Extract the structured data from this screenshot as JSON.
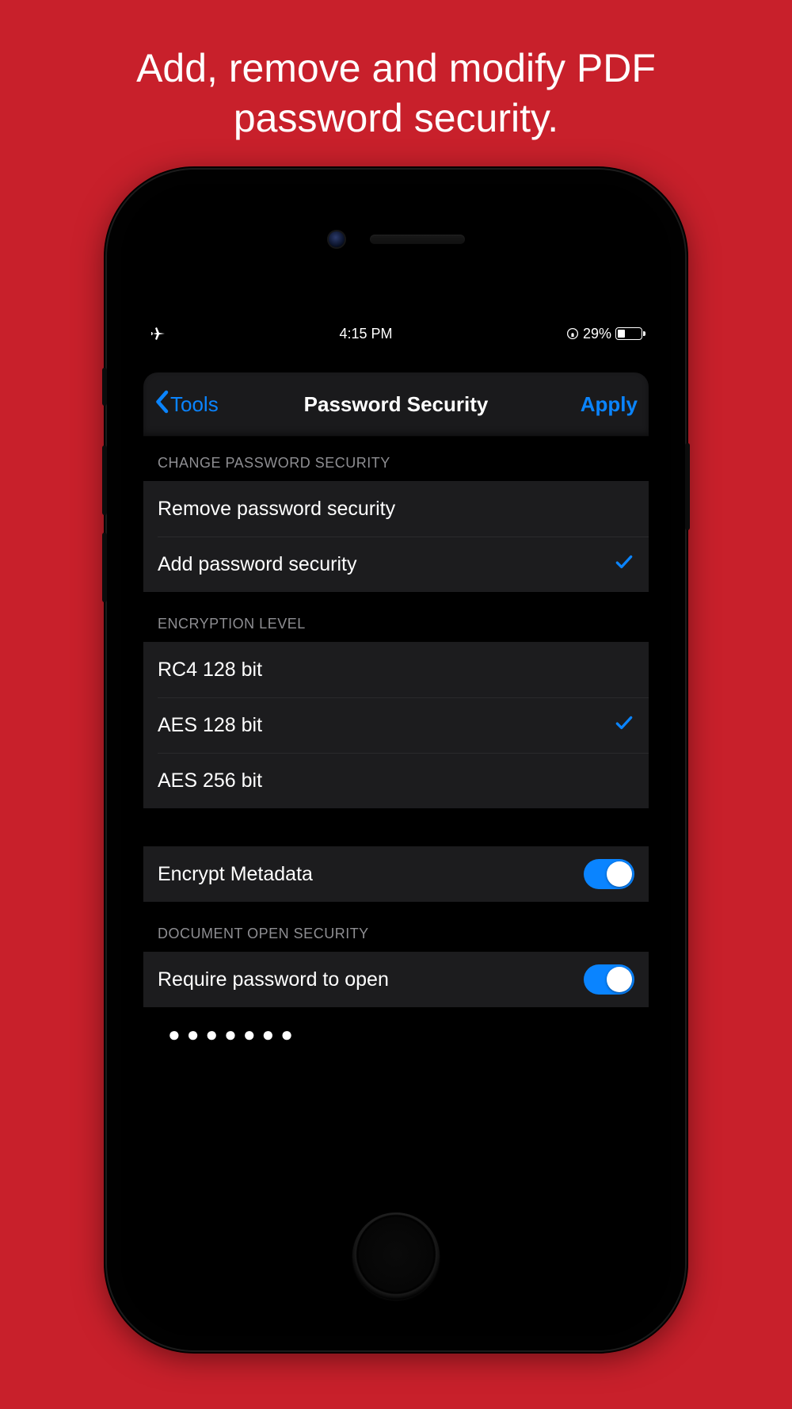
{
  "promo": {
    "title": "Add, remove and modify PDF password security."
  },
  "statusbar": {
    "time": "4:15 PM",
    "battery_pct": "29%"
  },
  "navbar": {
    "back_label": "Tools",
    "title": "Password Security",
    "apply_label": "Apply"
  },
  "sections": {
    "change_header": "CHANGE PASSWORD SECURITY",
    "change_options": [
      {
        "label": "Remove password security",
        "selected": false
      },
      {
        "label": "Add password security",
        "selected": true
      }
    ],
    "encryption_header": "ENCRYPTION LEVEL",
    "encryption_options": [
      {
        "label": "RC4 128 bit",
        "selected": false
      },
      {
        "label": "AES 128 bit",
        "selected": true
      },
      {
        "label": "AES 256 bit",
        "selected": false
      }
    ],
    "encrypt_metadata": {
      "label": "Encrypt Metadata",
      "value": true
    },
    "doc_open_header": "DOCUMENT OPEN SECURITY",
    "require_open": {
      "label": "Require password to open",
      "value": true
    },
    "password_masked": "●●●●●●●"
  },
  "colors": {
    "accent": "#0a84ff",
    "brand_bg": "#c8202b"
  }
}
